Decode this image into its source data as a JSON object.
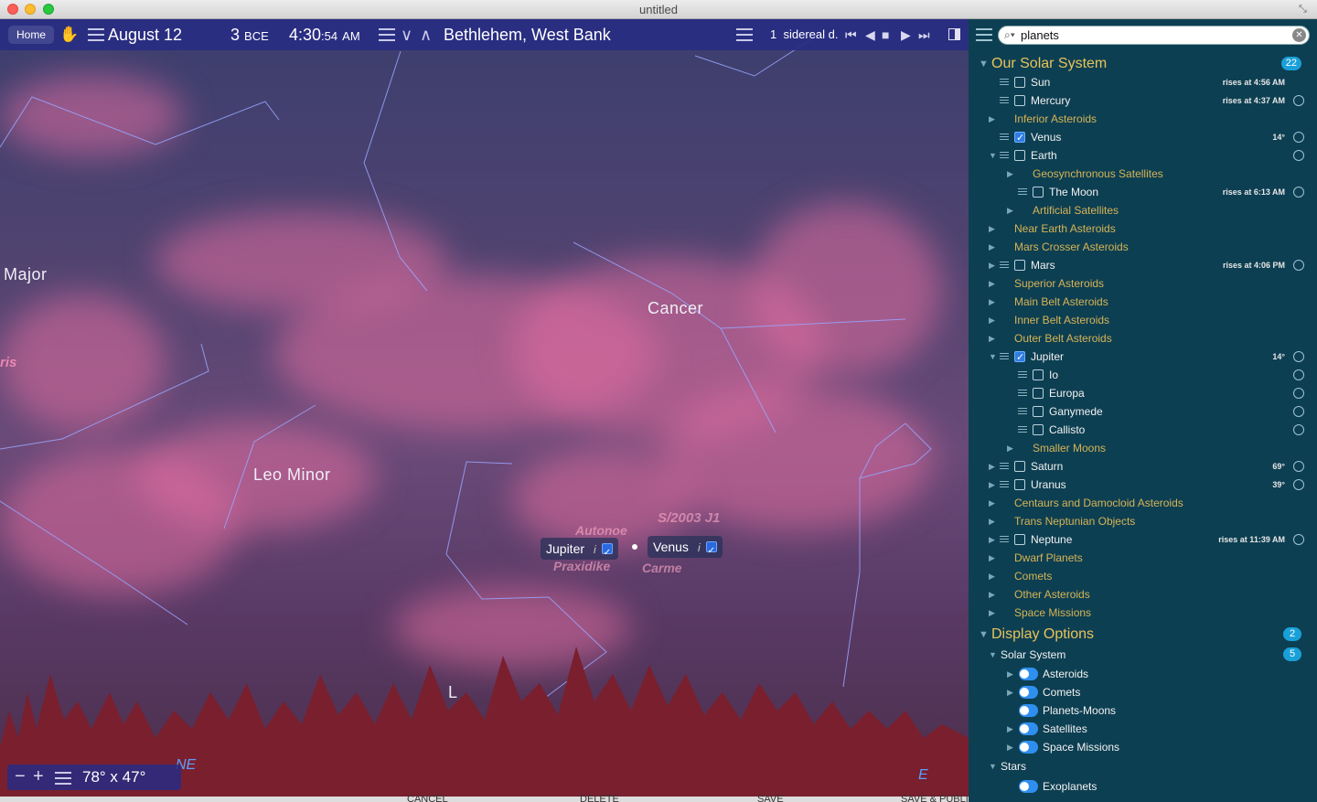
{
  "window": {
    "title": "untitled"
  },
  "toolbar": {
    "home_label": "Home",
    "date": "August 12",
    "year": "3",
    "era": "BCE",
    "time_hm": "4:30",
    "time_sep": ":",
    "time_s": "54",
    "time_ampm": "AM",
    "location": "Bethlehem, West Bank",
    "rate": "1",
    "rate_unit": "sidereal d."
  },
  "sky": {
    "constellations": [
      "Major",
      "Cancer",
      "Leo Minor",
      "L"
    ],
    "faint_fragment": "ris",
    "faint_labels": [
      "Autonoe",
      "S/2003 J1",
      "Praxidike",
      "Carme"
    ],
    "tags": [
      {
        "name": "Jupiter",
        "info": "i"
      },
      {
        "name": "Venus",
        "info": "i"
      }
    ],
    "fov": "78° x 47°",
    "compass_ne": "NE",
    "compass_e": "E"
  },
  "bottom_buttons": [
    "CANCEL",
    "DELETE",
    "SAVE",
    "SAVE & PUBLISH"
  ],
  "search": {
    "value": "planets",
    "placeholder": "Search"
  },
  "sidebar": {
    "solar_system": {
      "title": "Our Solar System",
      "count": "22",
      "rows": [
        {
          "label": "Sun",
          "type": "item",
          "status": "rises at 4:56 AM"
        },
        {
          "label": "Mercury",
          "type": "item",
          "status": "rises at 4:37 AM"
        },
        {
          "label": "Inferior Asteroids",
          "type": "group"
        },
        {
          "label": "Venus",
          "type": "item",
          "status": "14°"
        },
        {
          "label": "Earth",
          "type": "item",
          "status": ""
        },
        {
          "label": "Geosynchronous Satellites",
          "type": "group"
        },
        {
          "label": "The Moon",
          "type": "item",
          "status": "rises at 6:13 AM"
        },
        {
          "label": "Artificial Satellites",
          "type": "group"
        },
        {
          "label": "Near Earth Asteroids",
          "type": "group"
        },
        {
          "label": "Mars Crosser Asteroids",
          "type": "group"
        },
        {
          "label": "Mars",
          "type": "item",
          "status": "rises at 4:06 PM"
        },
        {
          "label": "Superior Asteroids",
          "type": "group"
        },
        {
          "label": "Main Belt Asteroids",
          "type": "group"
        },
        {
          "label": "Inner Belt Asteroids",
          "type": "group"
        },
        {
          "label": "Outer Belt Asteroids",
          "type": "group"
        },
        {
          "label": "Jupiter",
          "type": "item",
          "status": "14°"
        },
        {
          "label": "Io",
          "type": "item",
          "status": ""
        },
        {
          "label": "Europa",
          "type": "item",
          "status": ""
        },
        {
          "label": "Ganymede",
          "type": "item",
          "status": ""
        },
        {
          "label": "Callisto",
          "type": "item",
          "status": ""
        },
        {
          "label": "Smaller Moons",
          "type": "group"
        },
        {
          "label": "Saturn",
          "type": "item",
          "status": "69°"
        },
        {
          "label": "Uranus",
          "type": "item",
          "status": "39°"
        },
        {
          "label": "Centaurs and Damocloid Asteroids",
          "type": "group"
        },
        {
          "label": "Trans Neptunian Objects",
          "type": "group"
        },
        {
          "label": "Neptune",
          "type": "item",
          "status": "rises at 11:39 AM"
        },
        {
          "label": "Dwarf Planets",
          "type": "group"
        },
        {
          "label": "Comets",
          "type": "group"
        },
        {
          "label": "Other Asteroids",
          "type": "group"
        },
        {
          "label": "Space Missions",
          "type": "group"
        }
      ]
    },
    "display_options": {
      "title": "Display Options",
      "count": "2",
      "solar_system_label": "Solar System",
      "solar_system_count": "5",
      "toggles": [
        "Asteroids",
        "Comets",
        "Planets-Moons",
        "Satellites",
        "Space Missions"
      ],
      "stars_label": "Stars",
      "stars_toggles": [
        "Exoplanets"
      ]
    }
  }
}
